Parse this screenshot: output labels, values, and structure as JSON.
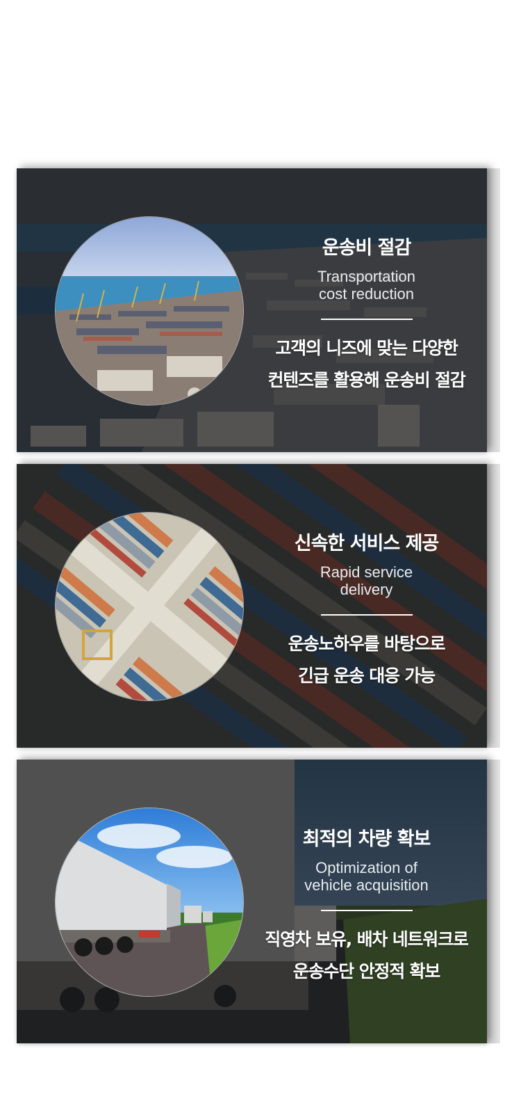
{
  "cards": [
    {
      "title": "운송비 절감",
      "subtitle_line1": "Transportation",
      "subtitle_line2": "cost reduction",
      "desc_line1": "고객의 니즈에 맞는 다양한",
      "desc_line2": "컨텐즈를 활용해 운송비 절감",
      "image": "port-aerial-image"
    },
    {
      "title": "신속한 서비스 제공",
      "subtitle_line1": "Rapid service",
      "subtitle_line2": "delivery",
      "desc_line1": "운송노하우를 바탕으로",
      "desc_line2": "긴급 운송 대응 가능",
      "image": "container-yard-image"
    },
    {
      "title": "최적의 차량 확보",
      "subtitle_line1": "Optimization of",
      "subtitle_line2": "vehicle acquisition",
      "desc_line1": "직영차 보유, 배차 네트워크로",
      "desc_line2": "운송수단 안정적 확보",
      "image": "truck-convoy-image"
    }
  ]
}
